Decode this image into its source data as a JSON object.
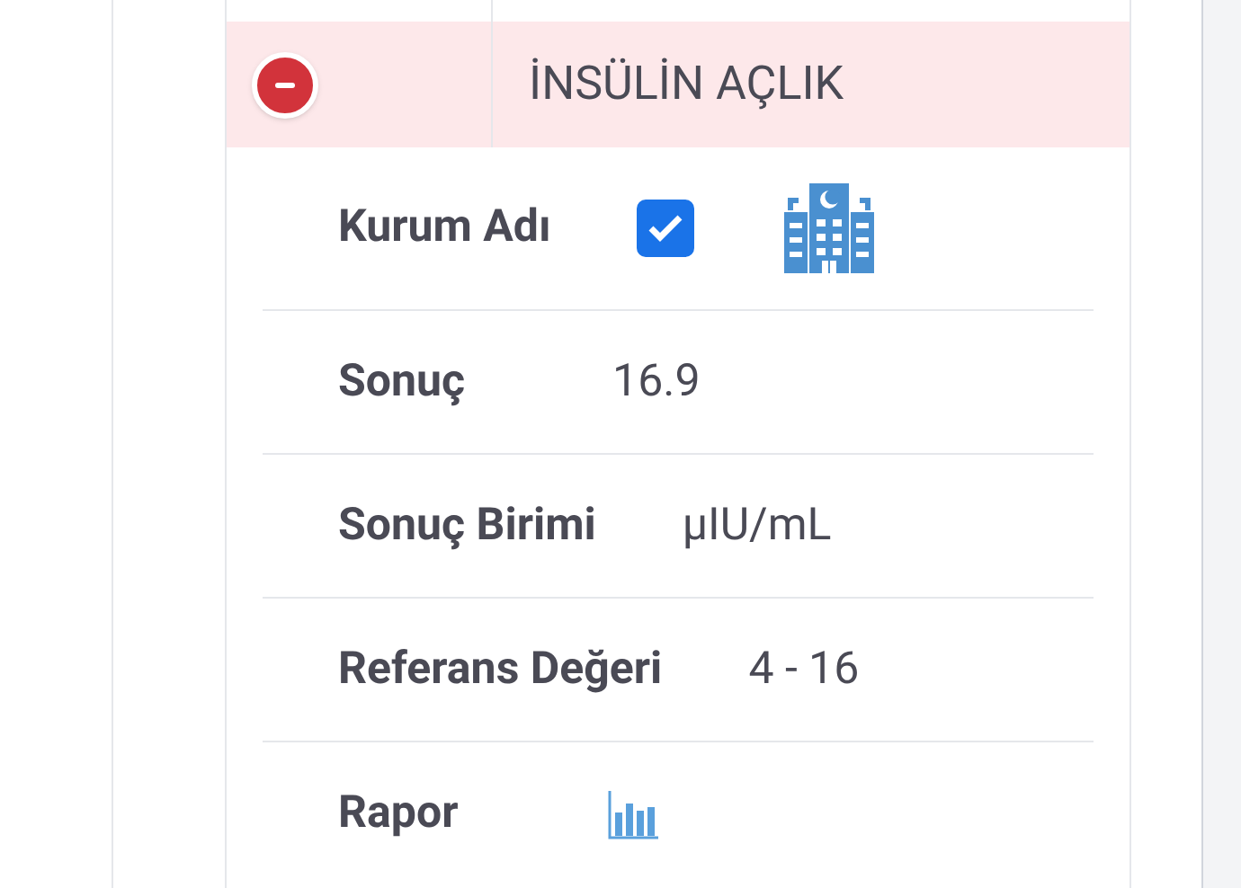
{
  "test": {
    "title": "İNSÜLİN AÇLIK",
    "expanded": true
  },
  "details": [
    {
      "kind": "checkbox",
      "label": "Kurum Adı",
      "checked": true
    },
    {
      "kind": "value",
      "label": "Sonuç",
      "value": "16.9"
    },
    {
      "kind": "value",
      "label": "Sonuç Birimi",
      "value": "µIU/mL"
    },
    {
      "kind": "value",
      "label": "Referans Değeri",
      "value": "4 - 16"
    },
    {
      "kind": "report",
      "label": "Rapor"
    }
  ]
}
